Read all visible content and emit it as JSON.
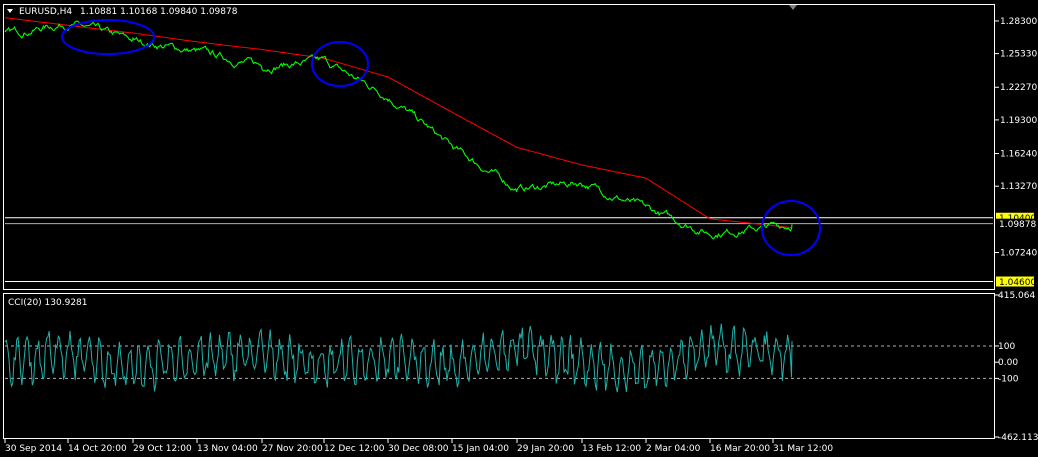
{
  "header": {
    "symbol": "EURUSD,H4",
    "ohlc": "1.10881 1.10168 1.09840 1.09878"
  },
  "indicator_label": "CCI(20) 130.9281",
  "colors": {
    "background": "#000000",
    "frame": "#ffffff",
    "price": "#00ff00",
    "ma": "#ff0000",
    "cci": "#20b2aa",
    "annotation": "#0000ff",
    "label_bg": "#ffff00"
  },
  "price_axis": {
    "ticks": [
      "1.28300",
      "1.25330",
      "1.22270",
      "1.19300",
      "1.16240",
      "1.13270",
      "1.07240"
    ],
    "ylim": [
      1.0401,
      1.2966
    ]
  },
  "price_labels": {
    "upper_level": "1.10400",
    "current": "1.09878",
    "lower_level": "1.04600"
  },
  "cci_axis": {
    "ticks": [
      "415.064",
      "100",
      "0.00",
      "-100",
      "-462.1133"
    ],
    "ylim": [
      -462.1133,
      415.064
    ]
  },
  "time_axis": [
    "30 Sep 2014",
    "14 Oct 20:00",
    "29 Oct 12:00",
    "13 Nov 04:00",
    "27 Nov 20:00",
    "12 Dec 12:00",
    "30 Dec 08:00",
    "15 Jan 04:00",
    "29 Jan 20:00",
    "13 Feb 12:00",
    "2 Mar 04:00",
    "16 Mar 20:00",
    "31 Mar 12:00"
  ],
  "chart_data": [
    {
      "type": "line",
      "x": [
        "30 Sep 2014",
        "14 Oct 20:00",
        "29 Oct 12:00",
        "13 Nov 04:00",
        "27 Nov 20:00",
        "12 Dec 12:00",
        "30 Dec 08:00",
        "15 Jan 04:00",
        "29 Jan 20:00",
        "13 Feb 12:00",
        "2 Mar 04:00",
        "16 Mar 20:00",
        "31 Mar 12:00"
      ],
      "series": [
        {
          "name": "EURUSD,H4",
          "values": [
            1.271,
            1.281,
            1.265,
            1.255,
            1.242,
            1.246,
            1.215,
            1.168,
            1.13,
            1.136,
            1.112,
            1.09,
            1.098
          ]
        },
        {
          "name": "",
          "values": [
            1.286,
            1.279,
            1.272,
            1.264,
            1.257,
            1.249,
            1.232,
            1.2,
            1.168,
            1.152,
            1.14,
            1.103,
            1.095
          ]
        }
      ],
      "ylim": [
        1.0401,
        1.2966
      ],
      "horizontal_levels": [
        1.104,
        1.0986,
        1.046
      ],
      "annotations": [
        "ellipse",
        "ellipse",
        "ellipse"
      ]
    },
    {
      "type": "line",
      "x": [
        "30 Sep 2014",
        "14 Oct 20:00",
        "29 Oct 12:00",
        "13 Nov 04:00",
        "27 Nov 20:00",
        "12 Dec 12:00",
        "30 Dec 08:00",
        "15 Jan 04:00",
        "29 Jan 20:00",
        "13 Feb 12:00",
        "2 Mar 04:00",
        "16 Mar 20:00",
        "31 Mar 12:00"
      ],
      "series": [
        {
          "name": "CCI(20)",
          "values": [
            20,
            150,
            -120,
            80,
            170,
            -60,
            110,
            -80,
            260,
            -40,
            -180,
            280,
            130.9281
          ]
        }
      ],
      "ylim": [
        -462.1133,
        415.064
      ],
      "levels": [
        100,
        0,
        -100
      ]
    }
  ]
}
